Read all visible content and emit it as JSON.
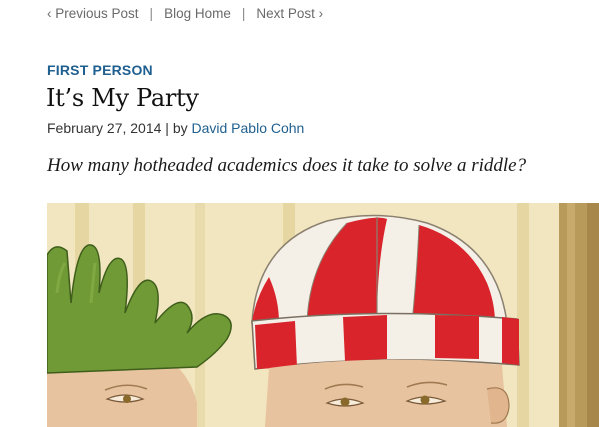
{
  "nav": {
    "previous_label": "‹ Previous Post",
    "separator": "|",
    "home_label": "Blog Home",
    "next_label": "Next Post ›"
  },
  "article": {
    "kicker": "FIRST PERSON",
    "title": "It’s My Party",
    "date": "February 27, 2014",
    "byline_sep": " | by ",
    "author": "David Pablo Cohn",
    "dek": "How many hotheaded academics does it take to solve a riddle?"
  },
  "hero_image": {
    "icon": "painting-illustration",
    "colors": {
      "background": "#efe3b8",
      "stripe": "#e2d097",
      "green_crown": "#6f9a35",
      "red": "#d9242b",
      "white_cap": "#f4f0e8",
      "skin": "#e8c39f",
      "pillar": "#b89a5a"
    }
  }
}
